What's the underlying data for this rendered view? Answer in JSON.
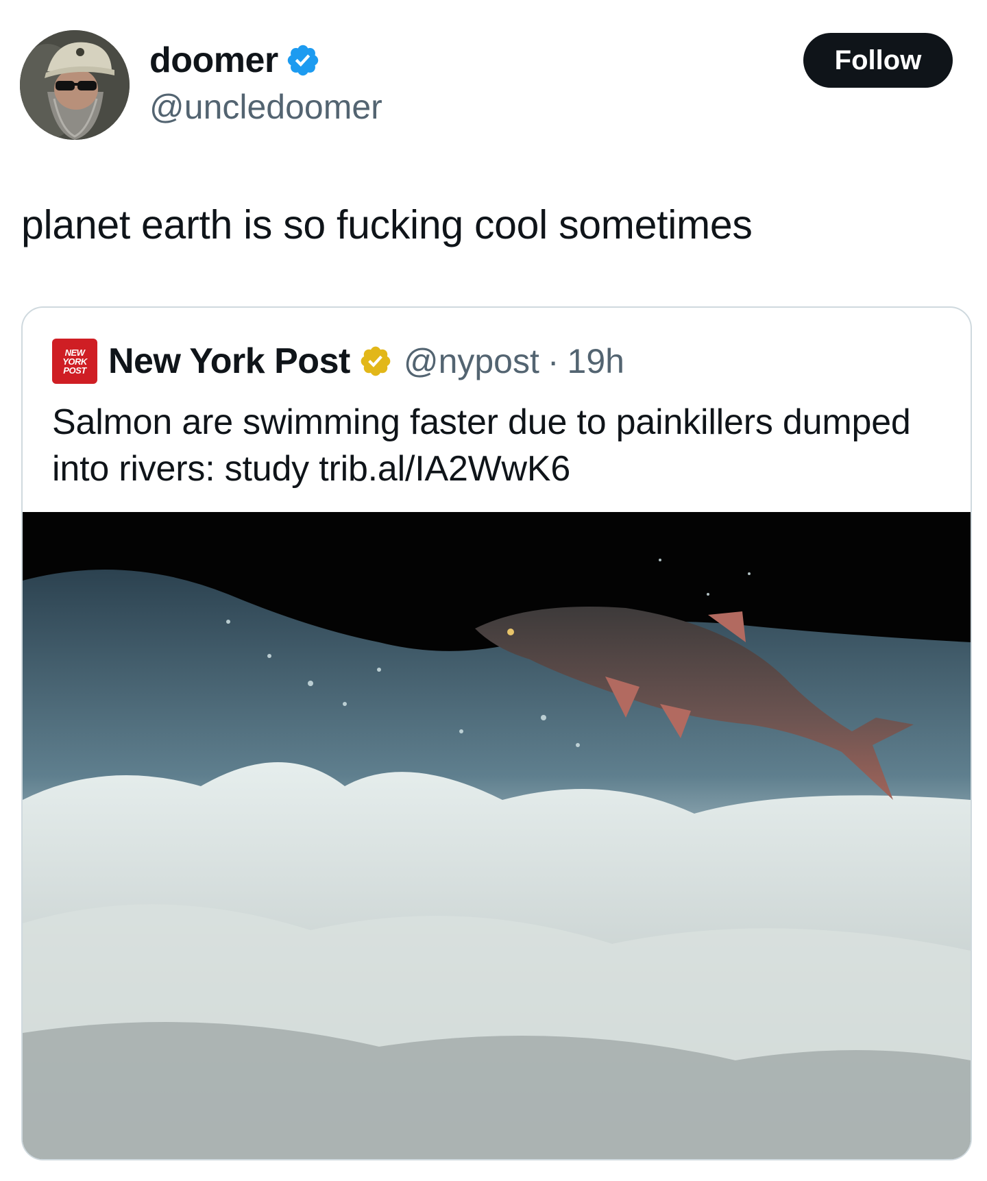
{
  "author": {
    "display_name": "doomer",
    "handle": "@uncledoomer",
    "verified_color": "#1d9bf0",
    "avatar_icon": "avatar-bearded-man-cap"
  },
  "follow_button": {
    "label": "Follow"
  },
  "tweet": {
    "text": "planet earth is so fucking cool sometimes"
  },
  "quote": {
    "logo_lines": [
      "NEW",
      "YORK",
      "POST"
    ],
    "logo_color": "#cf1e24",
    "name": "New York Post",
    "verified_color": "#e2b719",
    "handle": "@nypost",
    "separator": "·",
    "time": "19h",
    "text": "Salmon are swimming faster due to painkillers dumped into rivers: study trib.al/IA2WwK6",
    "image_icon": "salmon-leaping-rapids-photo"
  }
}
